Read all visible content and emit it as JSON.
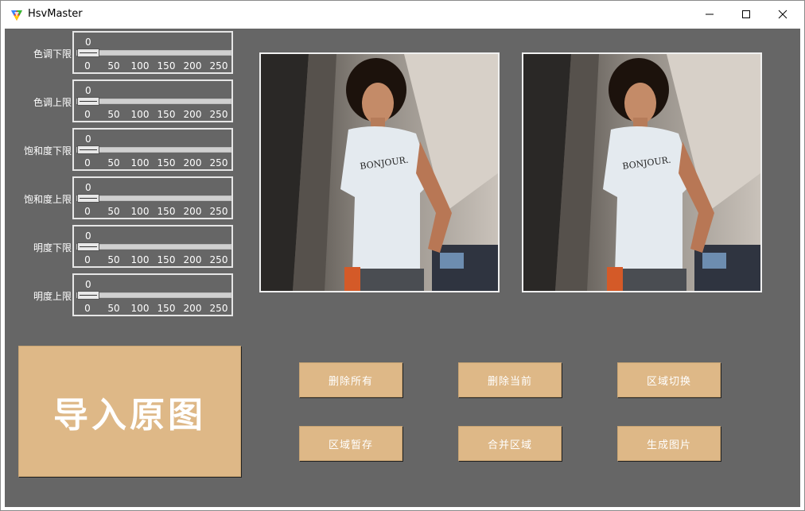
{
  "window": {
    "title": "HsvMaster",
    "controls": {
      "minimize": "minimize-icon",
      "maximize": "maximize-icon",
      "close": "close-icon"
    }
  },
  "sliders": [
    {
      "label": "色调下限",
      "value": "0"
    },
    {
      "label": "色调上限",
      "value": "0"
    },
    {
      "label": "饱和度下限",
      "value": "0"
    },
    {
      "label": "饱和度上限",
      "value": "0"
    },
    {
      "label": "明度下限",
      "value": "0"
    },
    {
      "label": "明度上限",
      "value": "0"
    }
  ],
  "scale_ticks": [
    "0",
    "50",
    "100",
    "150",
    "200",
    "250"
  ],
  "images": {
    "original_shirt_text": "BONJOUR.",
    "processed_shirt_text": "BONJOUR."
  },
  "buttons": {
    "import": "导入原图",
    "delete_all": "删除所有",
    "delete_current": "删除当前",
    "region_switch": "区域切换",
    "region_store": "区域暂存",
    "merge_regions": "合并区域",
    "generate_image": "生成图片"
  },
  "colors": {
    "background": "#666666",
    "button": "#deb887",
    "button_text": "#ffffff"
  }
}
